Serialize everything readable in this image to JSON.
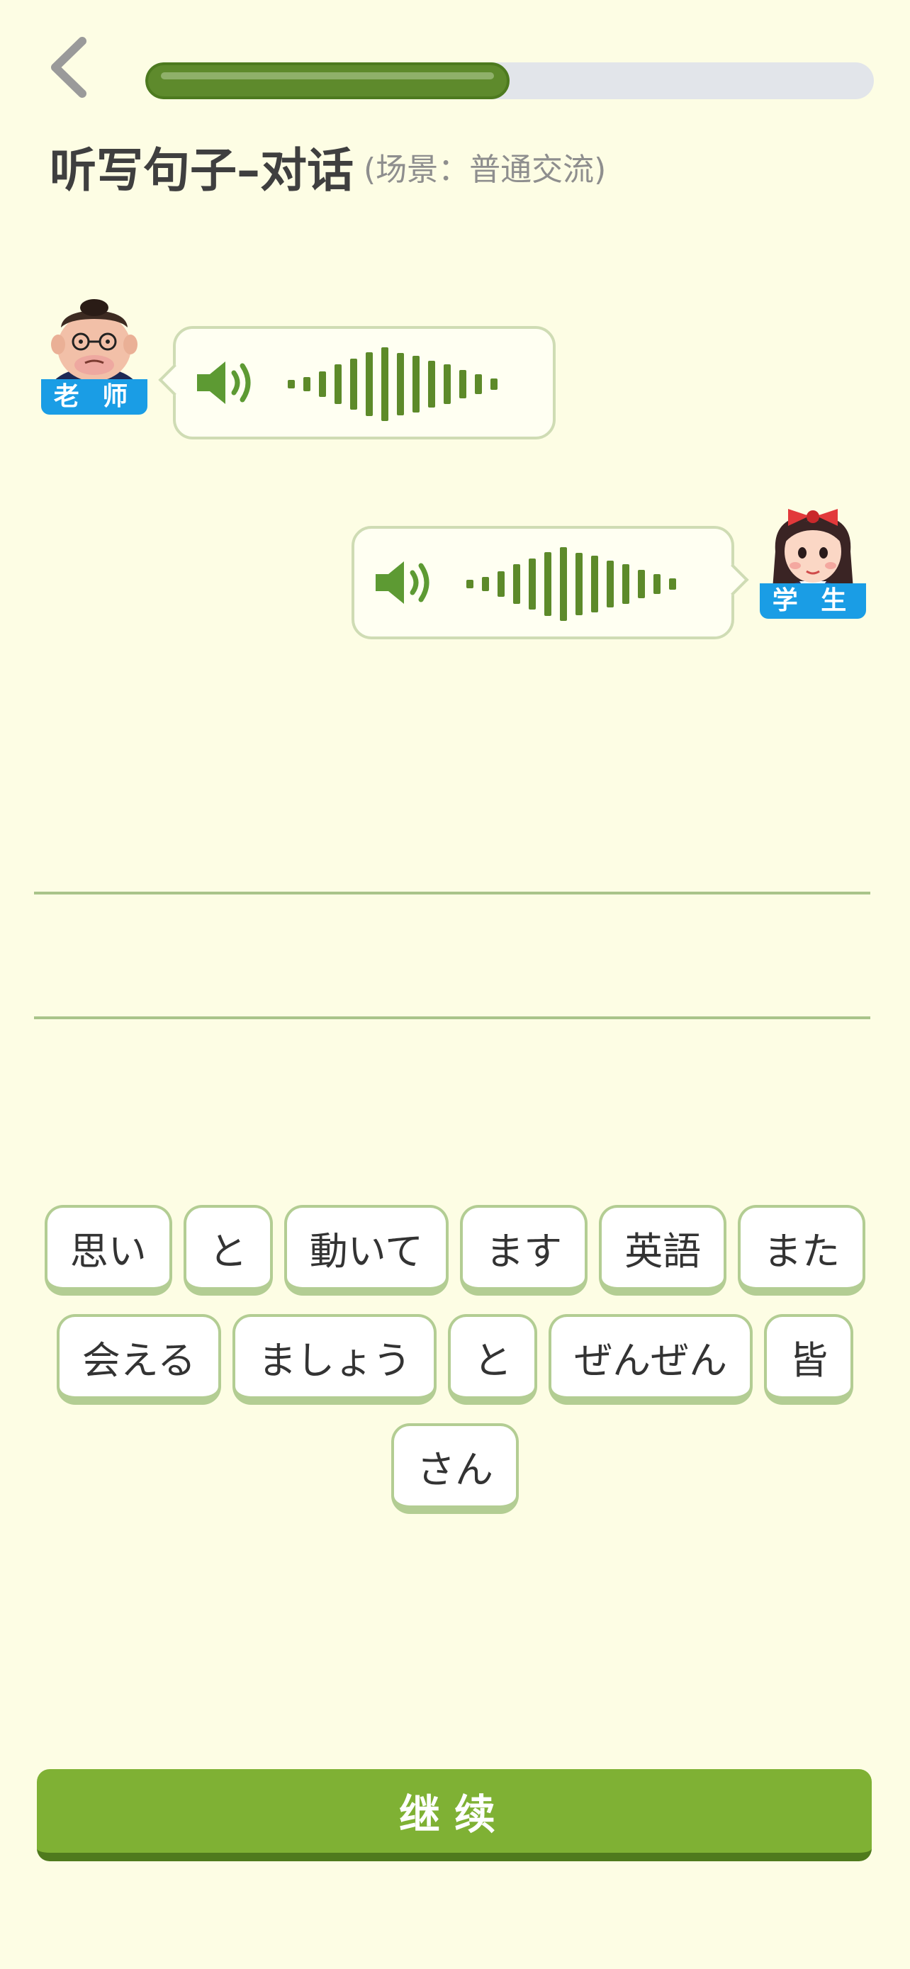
{
  "header": {
    "back_icon": "chevron-left-icon",
    "progress_fraction": 0.5,
    "title": "听写句子–对话",
    "subtitle": "(场景：普通交流)"
  },
  "dialog": {
    "teacher": {
      "label": "老 师",
      "avatar": "teacher-avatar"
    },
    "student": {
      "label": "学 生",
      "avatar": "student-avatar"
    },
    "speaker_icon": "speaker-icon",
    "waveform_icon": "audio-waveform-icon"
  },
  "word_bank": {
    "row1": [
      "思い",
      "と",
      "動いて",
      "ます",
      "英語",
      "また"
    ],
    "row2": [
      "会える",
      "ましょう",
      "と",
      "ぜんぜん",
      "皆"
    ],
    "row3": [
      "さん"
    ]
  },
  "colors": {
    "background": "#fdfde4",
    "accent_green": "#7fb134",
    "dark_green": "#5e8a2c",
    "tag_blue": "#1a9de5"
  },
  "footer": {
    "continue_label": "继续"
  }
}
